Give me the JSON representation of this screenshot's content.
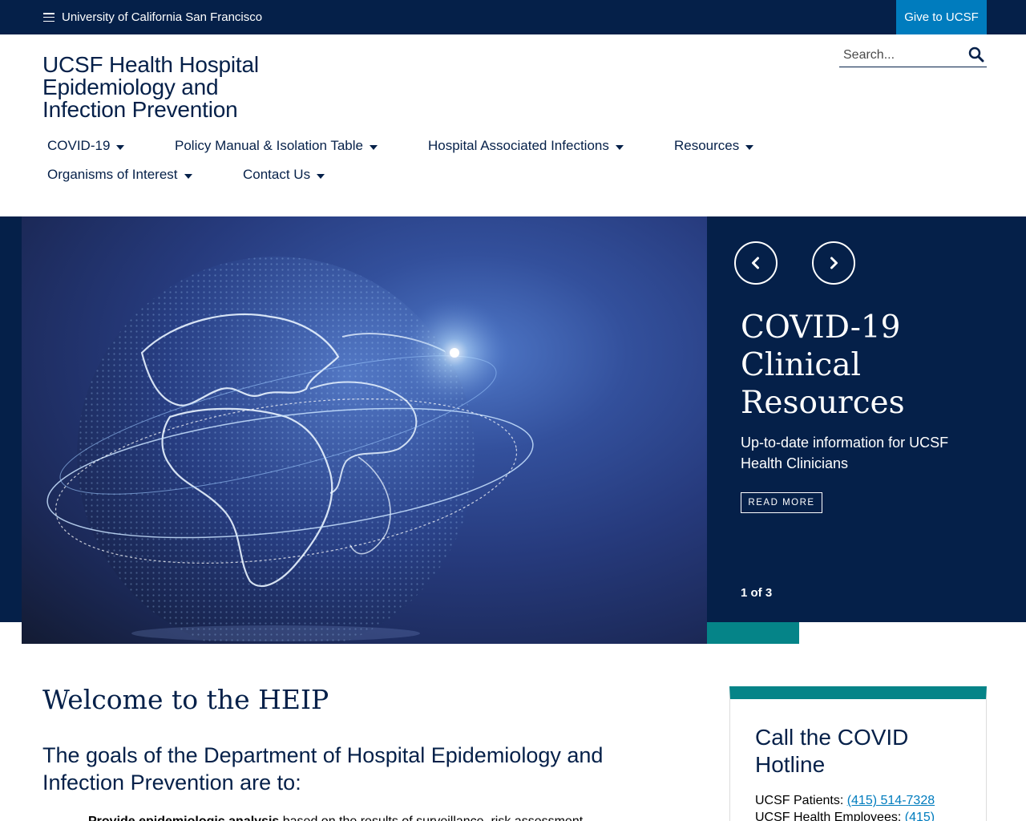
{
  "topbar": {
    "university": "University of California San Francisco",
    "give": "Give to UCSF"
  },
  "header": {
    "site_title_lines": [
      "UCSF Health Hospital",
      "Epidemiology and",
      "Infection Prevention"
    ],
    "search_placeholder": "Search..."
  },
  "nav": {
    "items": [
      {
        "label": "COVID-19"
      },
      {
        "label": "Policy Manual & Isolation Table"
      },
      {
        "label": "Hospital Associated Infections"
      },
      {
        "label": "Resources"
      },
      {
        "label": "Organisms of Interest"
      },
      {
        "label": "Contact Us"
      }
    ]
  },
  "hero": {
    "title": "COVID-19 Clinical Resources",
    "description": "Up-to-date information for UCSF Health Clinicians",
    "cta": "READ MORE",
    "slide_indicator": "1 of 3"
  },
  "main": {
    "welcome": "Welcome to the HEIP",
    "goals": "The goals of the Department of Hospital Epidemiology and Infection Prevention are to:",
    "bullet_bold": "Provide epidemiologic analysis",
    "bullet_rest": " based on the results of surveillance, risk assessment"
  },
  "card": {
    "title": "Call the COVID Hotline",
    "patients_label": "UCSF Patients: ",
    "patients_phone": "(415) 514-7328",
    "employees_label": "UCSF Health Employees: ",
    "employees_phone": "(415)"
  },
  "colors": {
    "navy": "#052049",
    "blue": "#007cbe",
    "teal": "#058488"
  }
}
